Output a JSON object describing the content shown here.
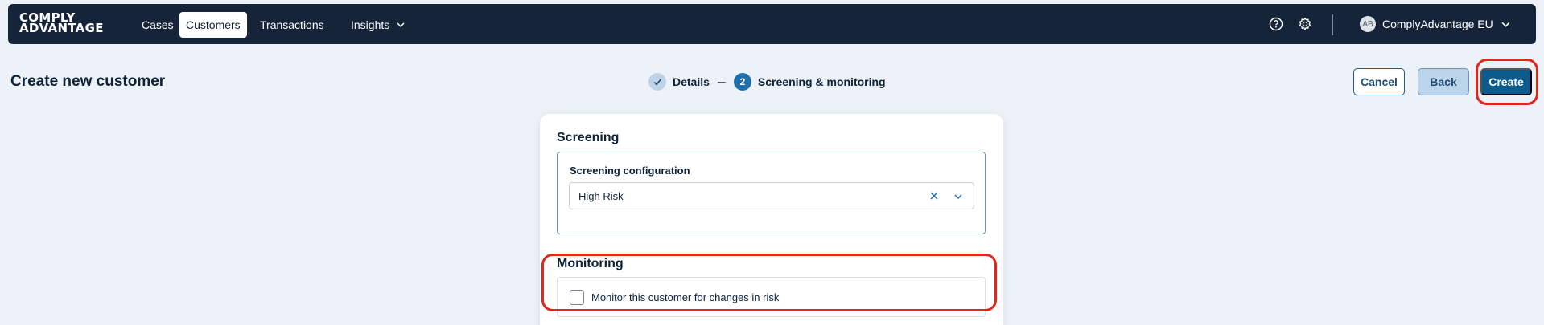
{
  "brand": {
    "line1": "COMPLY",
    "line2": "ADVANTAGE"
  },
  "nav": {
    "items": [
      {
        "label": "Cases"
      },
      {
        "label": "Customers",
        "active": true
      },
      {
        "label": "Transactions"
      },
      {
        "label": "Insights"
      }
    ],
    "help_icon": "question-circle-icon",
    "settings_icon": "gear-icon",
    "avatar_initials": "AB",
    "org_name": "ComplyAdvantage EU"
  },
  "page": {
    "title": "Create new customer",
    "steps": [
      {
        "label": "Details",
        "state": "done"
      },
      {
        "number": "2",
        "label": "Screening & monitoring",
        "state": "current"
      }
    ],
    "buttons": {
      "cancel": "Cancel",
      "back": "Back",
      "create": "Create"
    }
  },
  "form": {
    "screening": {
      "title": "Screening",
      "field_label": "Screening configuration",
      "value": "High Risk"
    },
    "monitoring": {
      "title": "Monitoring",
      "checkbox_label": "Monitor this customer for changes in risk",
      "checked": false
    }
  },
  "colors": {
    "nav_bg": "#16243a",
    "page_bg": "#edf2f8",
    "primary": "#0d5a8d",
    "highlight": "#e1261c"
  }
}
